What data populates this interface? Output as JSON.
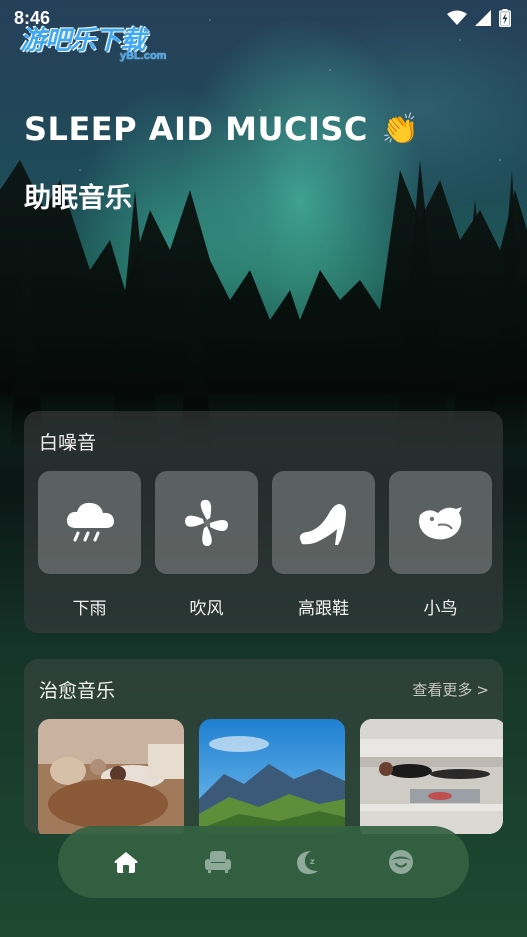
{
  "status_bar": {
    "time": "8:46",
    "icons": [
      "wifi-icon",
      "signal-icon",
      "battery-charging-icon"
    ]
  },
  "watermark": {
    "title": "游吧乐下载",
    "subtitle": "yBL.com"
  },
  "hero": {
    "title": "SLEEP AID MUCISC",
    "title_emoji": "👏",
    "subtitle": "助眠音乐"
  },
  "white_noise": {
    "title": "白噪音",
    "items": [
      {
        "label": "下雨",
        "icon": "rain-cloud-icon"
      },
      {
        "label": "吹风",
        "icon": "fan-icon"
      },
      {
        "label": "高跟鞋",
        "icon": "high-heel-icon"
      },
      {
        "label": "小鸟",
        "icon": "bird-icon"
      }
    ]
  },
  "healing_music": {
    "title": "治愈音乐",
    "more_label": "查看更多",
    "more_chevron": ">",
    "thumbnails": [
      {
        "image": "sleeping-girl-bed-photo"
      },
      {
        "image": "mountain-landscape-photo"
      },
      {
        "image": "woman-on-sofa-photo"
      }
    ]
  },
  "bottom_nav": {
    "items": [
      {
        "icon": "home-icon",
        "active": true
      },
      {
        "icon": "sofa-icon",
        "active": false
      },
      {
        "icon": "moon-icon",
        "active": false
      },
      {
        "icon": "sleep-face-icon",
        "active": false
      }
    ]
  },
  "colors": {
    "watermark_blue": "#3fa9f5",
    "nav_bg": "#346242",
    "aurora_green": "#5ae6be"
  }
}
